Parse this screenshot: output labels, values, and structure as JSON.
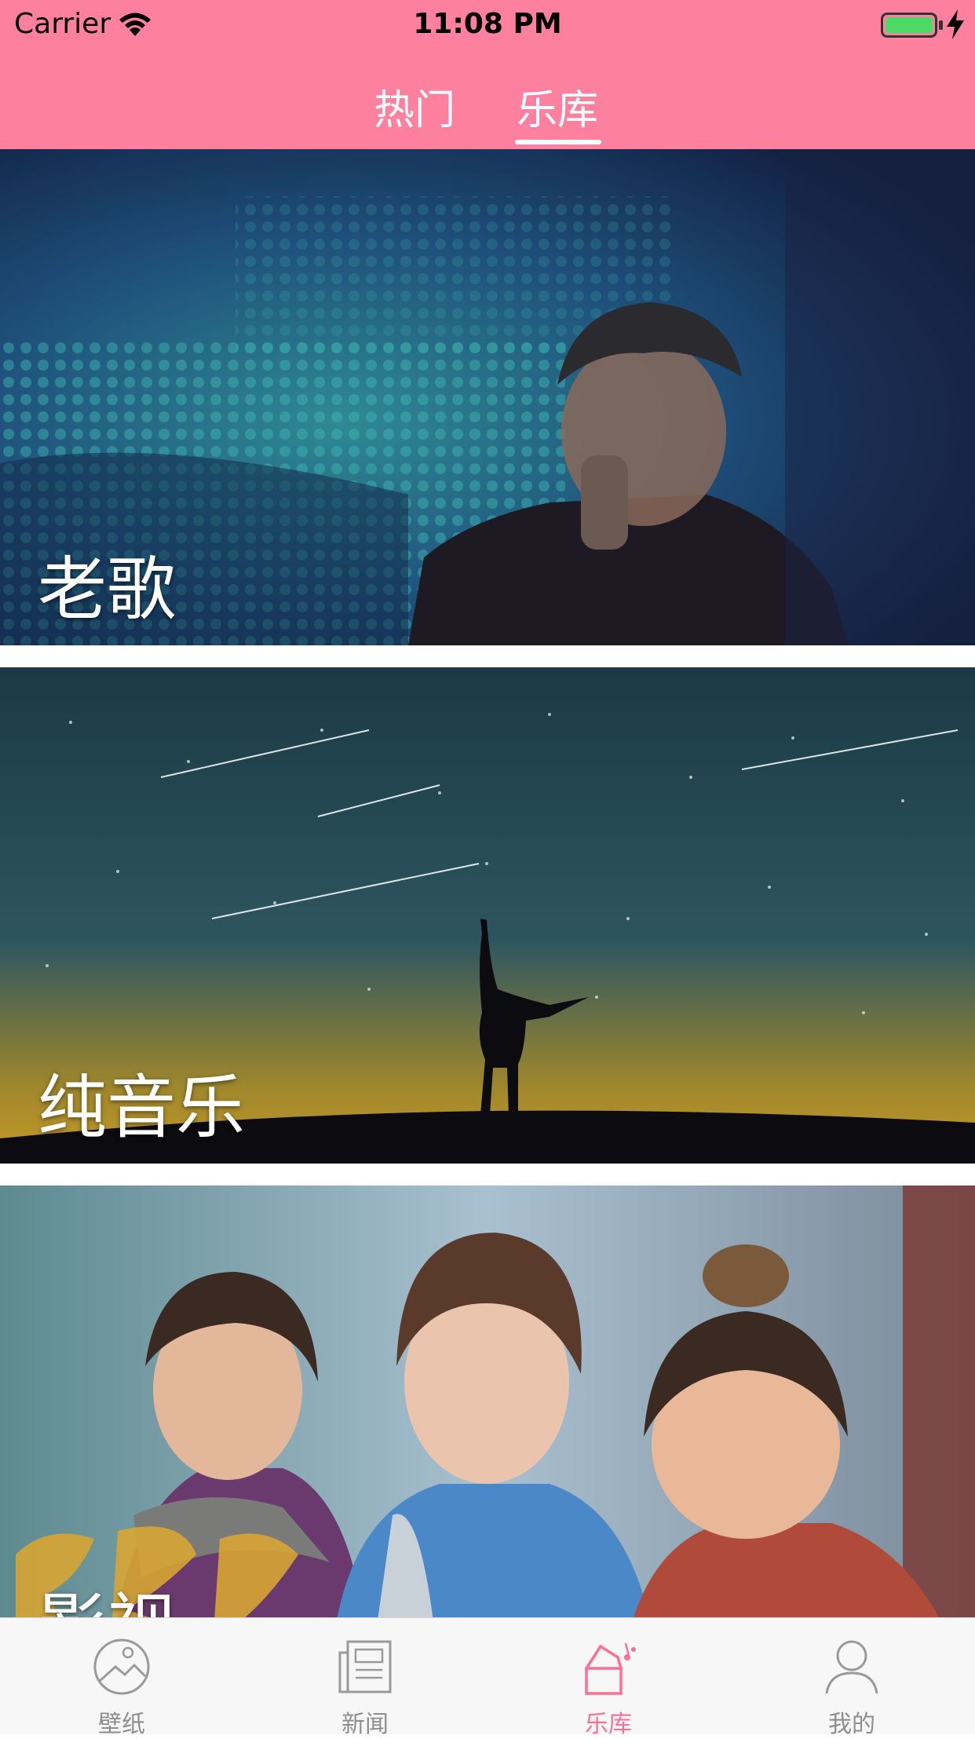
{
  "status_bar": {
    "carrier": "Carrier",
    "time": "11:08 PM"
  },
  "top_tabs": [
    {
      "label": "热门",
      "selected": false
    },
    {
      "label": "乐库",
      "selected": true
    }
  ],
  "cards": [
    {
      "title": "老歌"
    },
    {
      "title": "纯音乐"
    },
    {
      "title": "影视"
    }
  ],
  "tab_bar": [
    {
      "label": "壁纸",
      "icon": "wallpaper-icon",
      "selected": false
    },
    {
      "label": "新闻",
      "icon": "news-icon",
      "selected": false
    },
    {
      "label": "乐库",
      "icon": "music-library-icon",
      "selected": true
    },
    {
      "label": "我的",
      "icon": "profile-icon",
      "selected": false
    }
  ],
  "colors": {
    "accent": "#fd819f",
    "tab_active": "#fd6f94",
    "tab_inactive": "#8e8e8e"
  }
}
